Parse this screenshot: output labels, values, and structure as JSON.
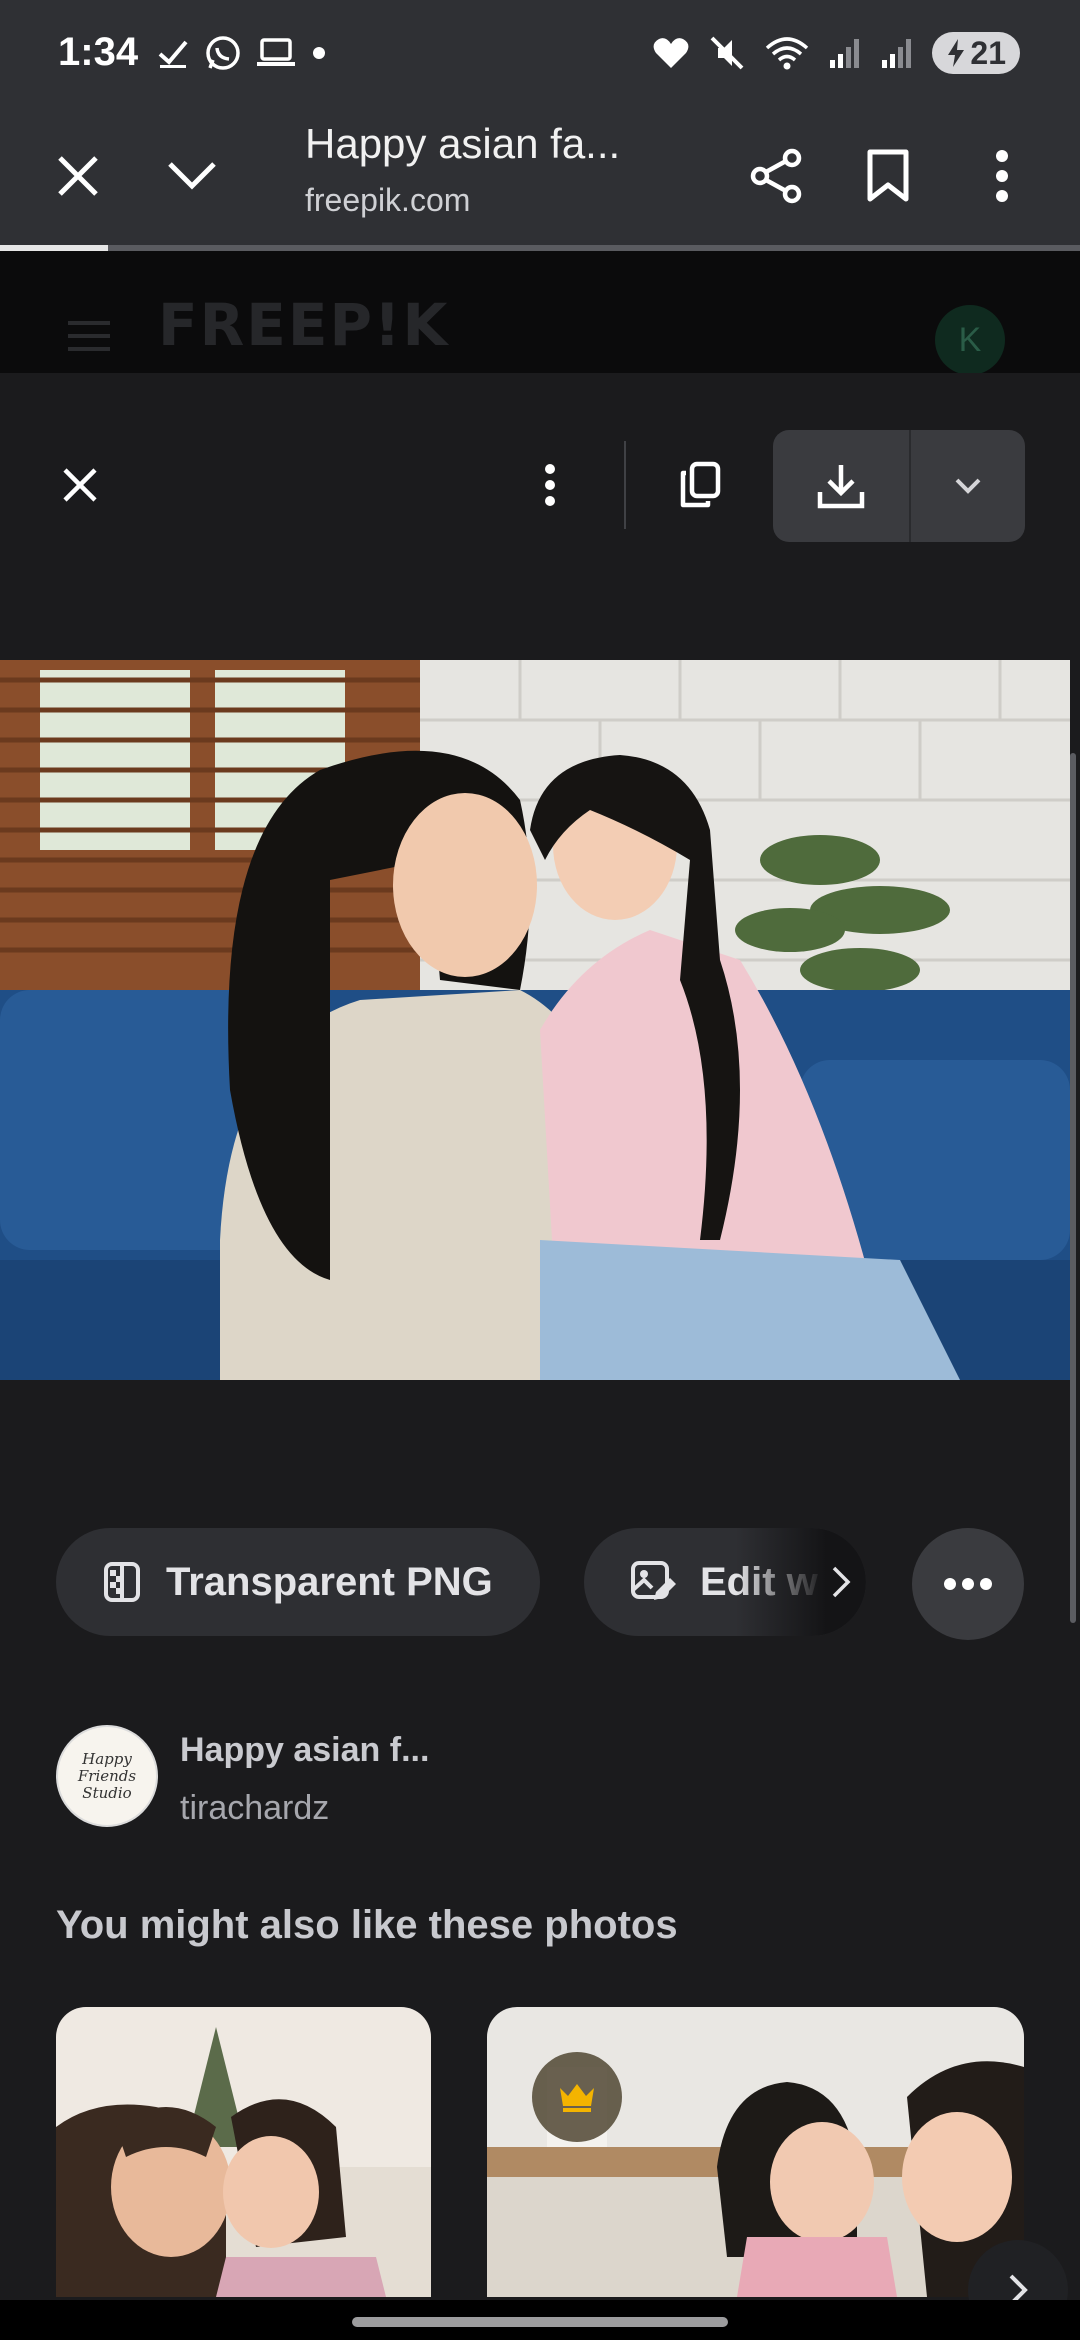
{
  "status_bar": {
    "time": "1:34",
    "battery_level": "21",
    "left_icons": [
      "check-icon",
      "whatsapp-icon",
      "laptop-icon",
      "dot-icon"
    ],
    "right_icons": [
      "heart-icon",
      "mute-icon",
      "wifi-icon",
      "signal-icon",
      "signal-icon",
      "battery-charging-icon"
    ]
  },
  "tab_toolbar": {
    "title": "Happy asian fa...",
    "url": "freepik.com",
    "page_load_progress": 0.1,
    "icons": [
      "close-icon",
      "chevron-down-icon",
      "share-icon",
      "bookmark-icon",
      "more-vert-icon"
    ]
  },
  "site_header": {
    "logo": "FREEP!K",
    "user_initial": "K",
    "menu_icon": "hamburger-icon"
  },
  "modal": {
    "icons": [
      "close-icon",
      "more-vert-icon",
      "copy-icon",
      "download-icon",
      "chevron-down-icon"
    ]
  },
  "actions": {
    "transparent_png_label": "Transparent PNG",
    "edit_label": "Edit w",
    "icons": [
      "transparent-png-icon",
      "edit-image-icon",
      "chevron-right-icon",
      "more-horiz-icon"
    ]
  },
  "author": {
    "title": "Happy asian f...",
    "name": "tirachardz",
    "avatar_text": "Happy Friends Studio"
  },
  "related": {
    "heading": "You might also like these photos",
    "premium_icon": "crown-icon",
    "next_icon": "chevron-right-icon"
  },
  "colors": {
    "toolbar_bg": "#2f3034",
    "page_bg": "#1b1b1d",
    "chip_bg": "#2e2f33",
    "premium_gold": "#f4b400"
  }
}
